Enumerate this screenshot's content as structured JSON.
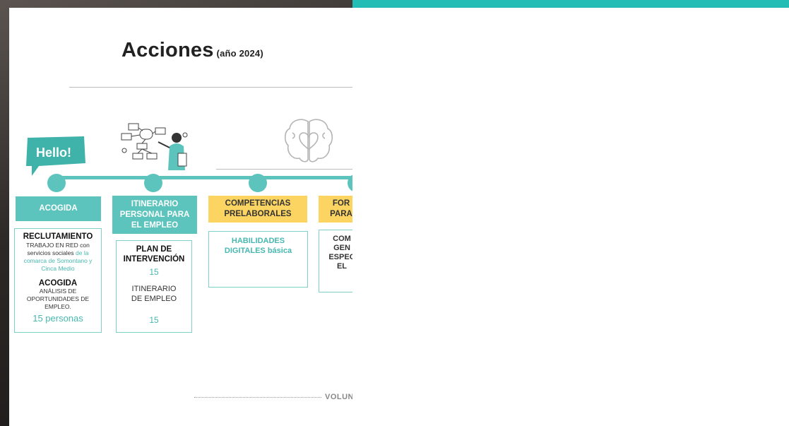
{
  "page": {
    "title": "Acciones",
    "title_sub": "(año 2024)",
    "hello_label": "Hello!",
    "footer": "VOLUN"
  },
  "colors": {
    "teal": "#5cc4bd",
    "teal_bar": "#23bdb5",
    "yellow": "#fbd462"
  },
  "icons": [
    "hello-speech-bubble-icon",
    "woman-flowchart-illustration-icon",
    "brain-heart-icon"
  ],
  "categories": [
    {
      "label": "ACOGIDA",
      "color": "teal"
    },
    {
      "label": "ITINERARIO PERSONAL PARA EL EMPLEO",
      "color": "teal"
    },
    {
      "label": "COMPETENCIAS PRELABORALES",
      "color": "yellow"
    },
    {
      "label": "FOR PARA",
      "color": "yellow"
    }
  ],
  "cards": {
    "acogida": {
      "h1": "RECLUTAMIENTO",
      "t1a": "TRABAJO EN RED con",
      "t1b": "servicios sociales",
      "t1c": "de la comarca de Somontano y Cinca Medio",
      "h2": "ACOGIDA",
      "t2": "ANÁLISIS DE OPORTUNIDADES DE EMPLEO.",
      "count": "15 personas"
    },
    "itinerario": {
      "h1": "PLAN DE INTERVENCIÓN",
      "n1": "15",
      "h2": "ITINERARIO DE EMPLEO",
      "n2": "15"
    },
    "competencias": {
      "t1": "HABILIDADES DIGITALES",
      "t2": "básica"
    },
    "formacion": {
      "t1": "COM GEN ESPEC EL"
    }
  }
}
